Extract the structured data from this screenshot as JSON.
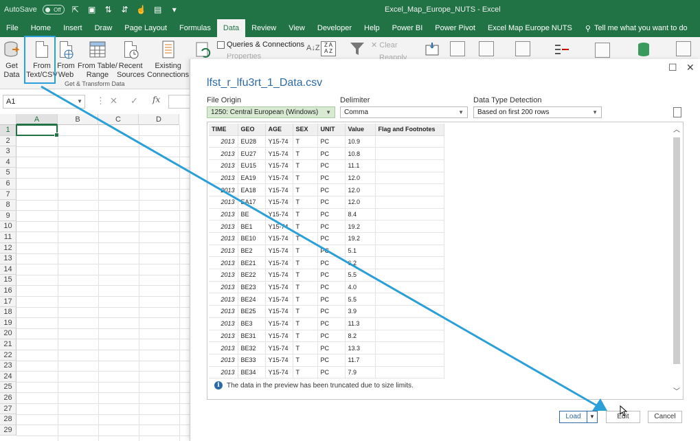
{
  "titlebar": {
    "autosave_label": "AutoSave",
    "autosave_state": "Off",
    "title": "Excel_Map_Europe_NUTS  -  Excel"
  },
  "tabs": [
    "File",
    "Home",
    "Insert",
    "Draw",
    "Page Layout",
    "Formulas",
    "Data",
    "Review",
    "View",
    "Developer",
    "Help",
    "Power BI",
    "Power Pivot",
    "Excel Map Europe NUTS"
  ],
  "active_tab": "Data",
  "tellme": "Tell me what you want to do",
  "ribbon": {
    "get_data": [
      "Get",
      "Data"
    ],
    "from_text": [
      "From",
      "Text/CSV"
    ],
    "from_web": [
      "From",
      "Web"
    ],
    "from_table": [
      "From Table/",
      "Range"
    ],
    "recent_sources": [
      "Recent",
      "Sources"
    ],
    "existing_connections": [
      "Existing",
      "Connections"
    ],
    "group_label": "Get & Transform Data",
    "queries_connections": "Queries & Connections",
    "properties": "Properties",
    "clear": "Clear",
    "reapply": "Reapply"
  },
  "formula_bar": {
    "name_box": "A1",
    "fx": "fx"
  },
  "grid": {
    "columns": [
      "A",
      "B",
      "C",
      "D"
    ],
    "rows": [
      "1",
      "2",
      "3",
      "4",
      "5",
      "6",
      "7",
      "8",
      "9",
      "10",
      "11",
      "12",
      "13",
      "14",
      "15",
      "16",
      "17",
      "18",
      "19",
      "20",
      "21",
      "22",
      "23",
      "24",
      "25",
      "26",
      "27",
      "28",
      "29"
    ]
  },
  "dialog": {
    "title": "lfst_r_lfu3rt_1_Data.csv",
    "file_origin_label": "File Origin",
    "file_origin_value": "1250: Central European (Windows)",
    "delimiter_label": "Delimiter",
    "delimiter_value": "Comma",
    "detection_label": "Data Type Detection",
    "detection_value": "Based on first 200 rows",
    "columns": [
      "TIME",
      "GEO",
      "AGE",
      "SEX",
      "UNIT",
      "Value",
      "Flag and Footnotes"
    ],
    "rows": [
      [
        "2013",
        "EU28",
        "Y15-74",
        "T",
        "PC",
        "10.9",
        ""
      ],
      [
        "2013",
        "EU27",
        "Y15-74",
        "T",
        "PC",
        "10.8",
        ""
      ],
      [
        "2013",
        "EU15",
        "Y15-74",
        "T",
        "PC",
        "11.1",
        ""
      ],
      [
        "2013",
        "EA19",
        "Y15-74",
        "T",
        "PC",
        "12.0",
        ""
      ],
      [
        "2013",
        "EA18",
        "Y15-74",
        "T",
        "PC",
        "12.0",
        ""
      ],
      [
        "2013",
        "EA17",
        "Y15-74",
        "T",
        "PC",
        "12.0",
        ""
      ],
      [
        "2013",
        "BE",
        "Y15-74",
        "T",
        "PC",
        "8.4",
        ""
      ],
      [
        "2013",
        "BE1",
        "Y15-74",
        "T",
        "PC",
        "19.2",
        ""
      ],
      [
        "2013",
        "BE10",
        "Y15-74",
        "T",
        "PC",
        "19.2",
        ""
      ],
      [
        "2013",
        "BE2",
        "Y15-74",
        "T",
        "PC",
        "5.1",
        ""
      ],
      [
        "2013",
        "BE21",
        "Y15-74",
        "T",
        "PC",
        "6.2",
        ""
      ],
      [
        "2013",
        "BE22",
        "Y15-74",
        "T",
        "PC",
        "5.5",
        ""
      ],
      [
        "2013",
        "BE23",
        "Y15-74",
        "T",
        "PC",
        "4.0",
        ""
      ],
      [
        "2013",
        "BE24",
        "Y15-74",
        "T",
        "PC",
        "5.5",
        ""
      ],
      [
        "2013",
        "BE25",
        "Y15-74",
        "T",
        "PC",
        "3.9",
        ""
      ],
      [
        "2013",
        "BE3",
        "Y15-74",
        "T",
        "PC",
        "11.3",
        ""
      ],
      [
        "2013",
        "BE31",
        "Y15-74",
        "T",
        "PC",
        "8.2",
        ""
      ],
      [
        "2013",
        "BE32",
        "Y15-74",
        "T",
        "PC",
        "13.3",
        ""
      ],
      [
        "2013",
        "BE33",
        "Y15-74",
        "T",
        "PC",
        "11.7",
        ""
      ],
      [
        "2013",
        "BE34",
        "Y15-74",
        "T",
        "PC",
        "7.9",
        ""
      ]
    ],
    "info_text": "The data in the preview has been truncated due to size limits.",
    "load_label": "Load",
    "edit_label": "Edit",
    "cancel_label": "Cancel"
  },
  "colors": {
    "excel_green": "#217346",
    "annotation_blue": "#2ba0d8",
    "dialog_title": "#2b6aa5"
  }
}
